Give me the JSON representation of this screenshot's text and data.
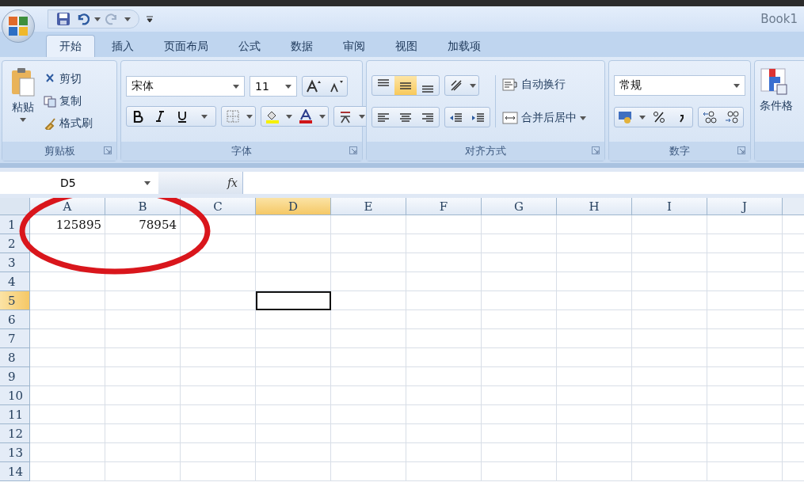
{
  "window": {
    "title": "Book1"
  },
  "tabs": [
    {
      "label": "开始",
      "selected": true
    },
    {
      "label": "插入",
      "selected": false
    },
    {
      "label": "页面布局",
      "selected": false
    },
    {
      "label": "公式",
      "selected": false
    },
    {
      "label": "数据",
      "selected": false
    },
    {
      "label": "审阅",
      "selected": false
    },
    {
      "label": "视图",
      "selected": false
    },
    {
      "label": "加载项",
      "selected": false
    }
  ],
  "clipboard": {
    "paste": "粘贴",
    "items": [
      "剪切",
      "复制",
      "格式刷"
    ],
    "label": "剪贴板"
  },
  "font": {
    "name": "宋体",
    "size": "11",
    "label": "字体"
  },
  "alignment": {
    "vertical": [
      {
        "on": false
      },
      {
        "on": true
      },
      {
        "on": false
      }
    ],
    "wrap": "自动换行",
    "merge": "合并后居中",
    "label": "对齐方式"
  },
  "number": {
    "format": "常规",
    "label": "数字"
  },
  "styles": {
    "conditional": "条件格"
  },
  "formula_bar": {
    "name_box": "D5",
    "fx": "fx"
  },
  "sheet": {
    "columns": [
      {
        "label": "A",
        "selected": false
      },
      {
        "label": "B",
        "selected": false
      },
      {
        "label": "C",
        "selected": false
      },
      {
        "label": "D",
        "selected": true
      },
      {
        "label": "E",
        "selected": false
      },
      {
        "label": "F",
        "selected": false
      },
      {
        "label": "G",
        "selected": false
      },
      {
        "label": "H",
        "selected": false
      },
      {
        "label": "I",
        "selected": false
      },
      {
        "label": "J",
        "selected": false
      }
    ],
    "rows": [
      {
        "label": "1",
        "selected": false,
        "cells": [
          "125895",
          "78954"
        ]
      },
      {
        "label": "2",
        "selected": false,
        "cells": []
      },
      {
        "label": "3",
        "selected": false,
        "cells": []
      },
      {
        "label": "4",
        "selected": false,
        "cells": []
      },
      {
        "label": "5",
        "selected": true,
        "cells": []
      },
      {
        "label": "6",
        "selected": false,
        "cells": []
      },
      {
        "label": "7",
        "selected": false,
        "cells": []
      },
      {
        "label": "8",
        "selected": false,
        "cells": []
      },
      {
        "label": "9",
        "selected": false,
        "cells": []
      },
      {
        "label": "10",
        "selected": false,
        "cells": []
      },
      {
        "label": "11",
        "selected": false,
        "cells": []
      },
      {
        "label": "12",
        "selected": false,
        "cells": []
      },
      {
        "label": "13",
        "selected": false,
        "cells": []
      },
      {
        "label": "14",
        "selected": false,
        "cells": []
      }
    ]
  }
}
